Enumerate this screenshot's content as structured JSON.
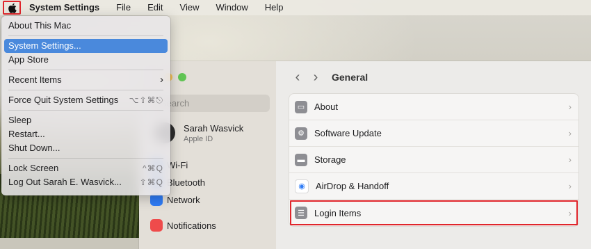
{
  "menubar": {
    "apple_icon": "apple-logo-icon",
    "app_name": "System Settings",
    "items": [
      "File",
      "Edit",
      "View",
      "Window",
      "Help"
    ]
  },
  "apple_menu": {
    "groups": [
      [
        {
          "label": "About This Mac",
          "shortcut": ""
        }
      ],
      [
        {
          "label": "System Settings...",
          "shortcut": "",
          "selected": true
        },
        {
          "label": "App Store",
          "shortcut": ""
        }
      ],
      [
        {
          "label": "Recent Items",
          "shortcut": "",
          "submenu": true
        }
      ],
      [
        {
          "label": "Force Quit System Settings",
          "shortcut": "⌥⇧⌘⎋"
        }
      ],
      [
        {
          "label": "Sleep",
          "shortcut": ""
        },
        {
          "label": "Restart...",
          "shortcut": ""
        },
        {
          "label": "Shut Down...",
          "shortcut": ""
        }
      ],
      [
        {
          "label": "Lock Screen",
          "shortcut": "^⌘Q"
        },
        {
          "label": "Log Out Sarah E. Wasvick...",
          "shortcut": "⇧⌘Q"
        }
      ]
    ],
    "submenu_chevron": "›"
  },
  "sidebar": {
    "search_placeholder": "Search",
    "profile": {
      "name": "Sarah Wasvick",
      "subtitle": "Apple ID"
    },
    "items": [
      {
        "label": "Wi-Fi",
        "color": "#2f7cf6"
      },
      {
        "label": "Bluetooth",
        "color": "#2f7cf6"
      },
      {
        "label": "Network",
        "color": "#2f7cf6"
      },
      {
        "label": "Notifications",
        "color": "#ef4b4b"
      }
    ]
  },
  "main": {
    "title": "General",
    "back": "‹",
    "forward": "›",
    "rows": [
      {
        "label": "About",
        "icon": "info-laptop-icon",
        "color": "#8e8e93"
      },
      {
        "label": "Software Update",
        "icon": "gear-badge-icon",
        "color": "#8e8e93"
      },
      {
        "label": "Storage",
        "icon": "drive-icon",
        "color": "#8e8e93"
      },
      {
        "label": "AirDrop & Handoff",
        "icon": "airdrop-icon",
        "color": "#2f7cf6"
      },
      {
        "label": "Login Items",
        "icon": "list-icon",
        "color": "#8e8e93",
        "highlight": true
      }
    ],
    "chevron": "›"
  },
  "colors": {
    "highlight_red": "#e0252b",
    "selection_blue": "#4a89dc"
  }
}
